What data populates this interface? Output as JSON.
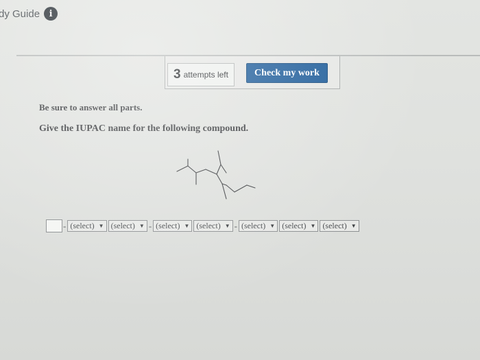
{
  "header": {
    "study_guide_label": "dy Guide",
    "info_icon": "info-icon",
    "info_glyph": "i"
  },
  "toolbar": {
    "attempts_count": "3",
    "attempts_label": "attempts left",
    "check_label": "Check my work",
    "check_color": "#1f5d9a"
  },
  "question": {
    "instruction": "Be sure to answer all parts.",
    "prompt": "Give the IUPAC name for the following compound."
  },
  "answer": {
    "separators": [
      "-",
      "-",
      "-"
    ],
    "selects": [
      {
        "value": "(select)"
      },
      {
        "value": "(select)"
      },
      {
        "value": "(select)"
      },
      {
        "value": "(select)"
      },
      {
        "value": "(select)"
      },
      {
        "value": "(select)"
      },
      {
        "value": "(select)"
      }
    ],
    "arrow_glyph": "▼"
  }
}
